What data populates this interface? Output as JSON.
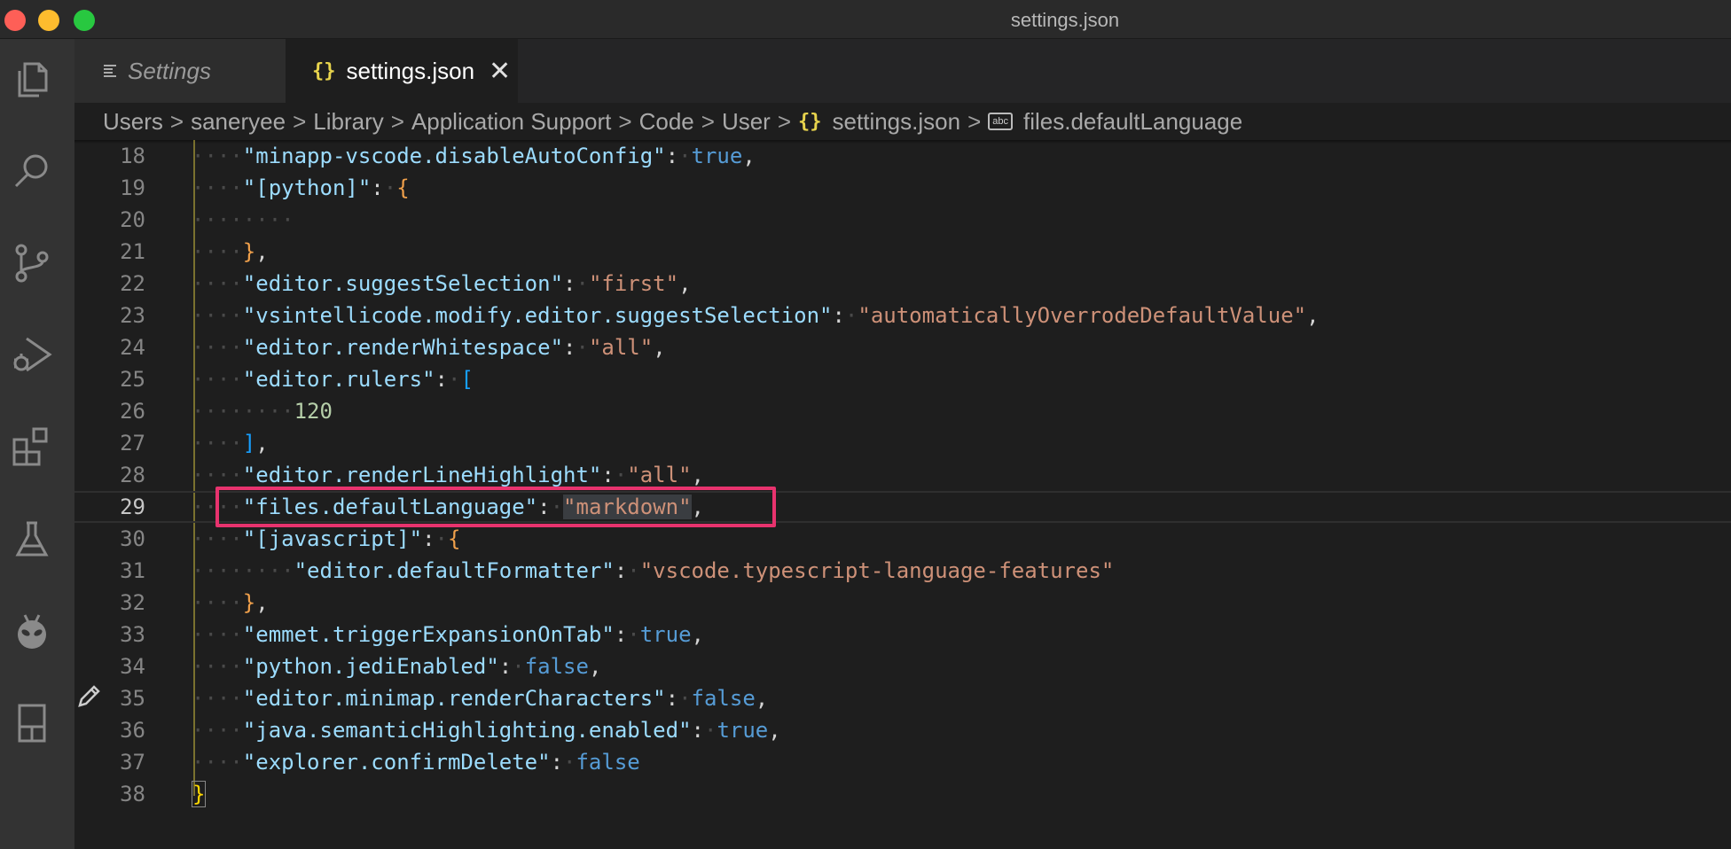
{
  "window": {
    "title": "settings.json"
  },
  "activity_bar": {
    "items": [
      {
        "name": "explorer-icon"
      },
      {
        "name": "search-icon"
      },
      {
        "name": "source-control-icon"
      },
      {
        "name": "run-debug-icon"
      },
      {
        "name": "extensions-icon"
      },
      {
        "name": "testing-flask-icon"
      },
      {
        "name": "platformio-alien-icon"
      },
      {
        "name": "notebook-icon"
      }
    ]
  },
  "tabs": [
    {
      "label": "Settings",
      "icon": "settings-list-icon",
      "active": false
    },
    {
      "label": "settings.json",
      "icon": "json-braces-icon",
      "active": true
    }
  ],
  "breadcrumb": {
    "items": [
      "Users",
      "saneryee",
      "Library",
      "Application Support",
      "Code",
      "User",
      "settings.json",
      "files.defaultLanguage"
    ],
    "separator": ">",
    "braces": "{}",
    "abc": "abc"
  },
  "editor": {
    "current_line": 29,
    "lines": [
      {
        "num": "18",
        "indent": "····",
        "tokens": [
          {
            "t": "k",
            "v": "\"minapp-vscode.disableAutoConfig\""
          },
          {
            "t": "p",
            "v": ":"
          },
          {
            "t": "ws",
            "v": "·"
          },
          {
            "t": "b",
            "v": "true"
          },
          {
            "t": "p",
            "v": ","
          }
        ]
      },
      {
        "num": "19",
        "indent": "····",
        "tokens": [
          {
            "t": "k",
            "v": "\"[python]\""
          },
          {
            "t": "p",
            "v": ":"
          },
          {
            "t": "ws",
            "v": "·"
          },
          {
            "t": "br-or",
            "v": "{"
          }
        ]
      },
      {
        "num": "20",
        "indent": "········",
        "tokens": []
      },
      {
        "num": "21",
        "indent": "····",
        "tokens": [
          {
            "t": "br-or",
            "v": "}"
          },
          {
            "t": "p",
            "v": ","
          }
        ]
      },
      {
        "num": "22",
        "indent": "····",
        "tokens": [
          {
            "t": "k",
            "v": "\"editor.suggestSelection\""
          },
          {
            "t": "p",
            "v": ":"
          },
          {
            "t": "ws",
            "v": "·"
          },
          {
            "t": "s",
            "v": "\"first\""
          },
          {
            "t": "p",
            "v": ","
          }
        ]
      },
      {
        "num": "23",
        "indent": "····",
        "tokens": [
          {
            "t": "k",
            "v": "\"vsintellicode.modify.editor.suggestSelection\""
          },
          {
            "t": "p",
            "v": ":"
          },
          {
            "t": "ws",
            "v": "·"
          },
          {
            "t": "s",
            "v": "\"automaticallyOverrodeDefaultValue\""
          },
          {
            "t": "p",
            "v": ","
          }
        ]
      },
      {
        "num": "24",
        "indent": "····",
        "tokens": [
          {
            "t": "k",
            "v": "\"editor.renderWhitespace\""
          },
          {
            "t": "p",
            "v": ":"
          },
          {
            "t": "ws",
            "v": "·"
          },
          {
            "t": "s",
            "v": "\"all\""
          },
          {
            "t": "p",
            "v": ","
          }
        ]
      },
      {
        "num": "25",
        "indent": "····",
        "tokens": [
          {
            "t": "k",
            "v": "\"editor.rulers\""
          },
          {
            "t": "p",
            "v": ":"
          },
          {
            "t": "ws",
            "v": "·"
          },
          {
            "t": "br-bl",
            "v": "["
          }
        ]
      },
      {
        "num": "26",
        "indent": "········",
        "tokens": [
          {
            "t": "n",
            "v": "120"
          }
        ]
      },
      {
        "num": "27",
        "indent": "····",
        "tokens": [
          {
            "t": "br-bl",
            "v": "]"
          },
          {
            "t": "p",
            "v": ","
          }
        ]
      },
      {
        "num": "28",
        "indent": "····",
        "tokens": [
          {
            "t": "k",
            "v": "\"editor.renderLineHighlight\""
          },
          {
            "t": "p",
            "v": ":"
          },
          {
            "t": "ws",
            "v": "·"
          },
          {
            "t": "s",
            "v": "\"all\""
          },
          {
            "t": "p",
            "v": ","
          }
        ]
      },
      {
        "num": "29",
        "indent": "····",
        "tokens": [
          {
            "t": "k",
            "v": "\"files.defaultLanguage\""
          },
          {
            "t": "p",
            "v": ":"
          },
          {
            "t": "ws",
            "v": "·"
          },
          {
            "t": "s sel",
            "v": "\"markdown\""
          },
          {
            "t": "p",
            "v": ","
          }
        ]
      },
      {
        "num": "30",
        "indent": "····",
        "tokens": [
          {
            "t": "k",
            "v": "\"[javascript]\""
          },
          {
            "t": "p",
            "v": ":"
          },
          {
            "t": "ws",
            "v": "·"
          },
          {
            "t": "br-or",
            "v": "{"
          }
        ]
      },
      {
        "num": "31",
        "indent": "········",
        "tokens": [
          {
            "t": "k",
            "v": "\"editor.defaultFormatter\""
          },
          {
            "t": "p",
            "v": ":"
          },
          {
            "t": "ws",
            "v": "·"
          },
          {
            "t": "s",
            "v": "\"vscode.typescript-language-features\""
          }
        ]
      },
      {
        "num": "32",
        "indent": "····",
        "tokens": [
          {
            "t": "br-or",
            "v": "}"
          },
          {
            "t": "p",
            "v": ","
          }
        ]
      },
      {
        "num": "33",
        "indent": "····",
        "tokens": [
          {
            "t": "k",
            "v": "\"emmet.triggerExpansionOnTab\""
          },
          {
            "t": "p",
            "v": ":"
          },
          {
            "t": "ws",
            "v": "·"
          },
          {
            "t": "b",
            "v": "true"
          },
          {
            "t": "p",
            "v": ","
          }
        ]
      },
      {
        "num": "34",
        "indent": "····",
        "tokens": [
          {
            "t": "k",
            "v": "\"python.jediEnabled\""
          },
          {
            "t": "p",
            "v": ":"
          },
          {
            "t": "ws",
            "v": "·"
          },
          {
            "t": "b",
            "v": "false"
          },
          {
            "t": "p",
            "v": ","
          }
        ]
      },
      {
        "num": "35",
        "indent": "····",
        "tokens": [
          {
            "t": "k",
            "v": "\"editor.minimap.renderCharacters\""
          },
          {
            "t": "p",
            "v": ":"
          },
          {
            "t": "ws",
            "v": "·"
          },
          {
            "t": "b",
            "v": "false"
          },
          {
            "t": "p",
            "v": ","
          }
        ]
      },
      {
        "num": "36",
        "indent": "····",
        "tokens": [
          {
            "t": "k",
            "v": "\"java.semanticHighlighting.enabled\""
          },
          {
            "t": "p",
            "v": ":"
          },
          {
            "t": "ws",
            "v": "·"
          },
          {
            "t": "b",
            "v": "true"
          },
          {
            "t": "p",
            "v": ","
          }
        ]
      },
      {
        "num": "37",
        "indent": "····",
        "tokens": [
          {
            "t": "k",
            "v": "\"explorer.confirmDelete\""
          },
          {
            "t": "p",
            "v": ":"
          },
          {
            "t": "ws",
            "v": "·"
          },
          {
            "t": "b",
            "v": "false"
          }
        ]
      },
      {
        "num": "38",
        "indent": "",
        "tokens": [
          {
            "t": "br-y",
            "v": "}"
          }
        ]
      }
    ]
  },
  "colors": {
    "highlight_box": "#e8336e",
    "json_key": "#9cdcfe",
    "json_string": "#ce9178",
    "json_bool": "#569cd6",
    "json_number": "#b5cea8"
  }
}
